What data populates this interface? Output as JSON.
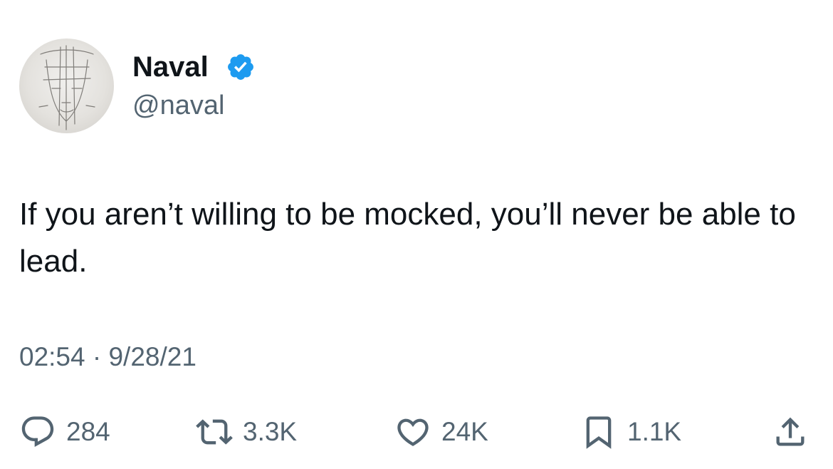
{
  "author": {
    "display_name": "Naval",
    "handle": "@naval",
    "verified": true,
    "verified_color": "#1d9bf0",
    "avatar_icon": "avatar-sketch-face"
  },
  "tweet": {
    "text": "If you aren’t willing to be mocked, you’ll never be able to lead.",
    "time": "02:54",
    "separator": "·",
    "date": "9/28/21"
  },
  "actions": {
    "reply": {
      "icon": "reply-icon",
      "count": "284"
    },
    "retweet": {
      "icon": "retweet-icon",
      "count": "3.3K"
    },
    "like": {
      "icon": "heart-icon",
      "count": "24K"
    },
    "bookmark": {
      "icon": "bookmark-icon",
      "count": "1.1K"
    },
    "share": {
      "icon": "share-icon"
    }
  },
  "colors": {
    "text_primary": "#0f1419",
    "text_secondary": "#536471",
    "accent": "#1d9bf0"
  }
}
